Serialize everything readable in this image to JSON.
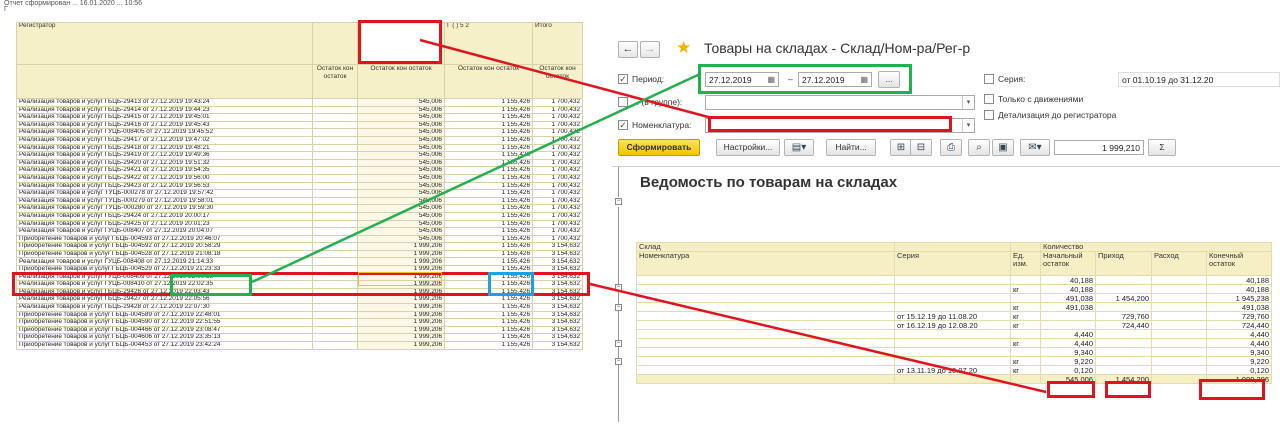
{
  "left_report": {
    "top_line": "Отчет сформирован ... 16.01.2020 ... 10:56",
    "top_line2": "Г",
    "headers": {
      "registrar": "Регистратор",
      "c2_top": "",
      "c3_top": "Г    (    ) 5   2",
      "total": "Итого",
      "c1_sub": "Остаток кон остаток",
      "c2_sub": "Остаток кон остаток",
      "c3_sub": "Остаток кон остаток",
      "c4_sub": "Остаток кон остаток"
    },
    "rows": [
      {
        "r": "Реализация товаров и услуг ГБЦБ-29413 от 27.12.2019 19:43:24",
        "a": "545,006",
        "b": "1 155,426",
        "t": "1 700,432"
      },
      {
        "r": "Реализация товаров и услуг ГБЦБ-29414 от 27.12.2019 19:44:23",
        "a": "545,006",
        "b": "1 155,426",
        "t": "1 700,432"
      },
      {
        "r": "Реализация товаров и услуг ГБЦБ-29415 от 27.12.2019 19:45:01",
        "a": "545,006",
        "b": "1 155,426",
        "t": "1 700,432"
      },
      {
        "r": "Реализация товаров и услуг ГБЦБ-29416 от 27.12.2019 19:45:43",
        "a": "545,006",
        "b": "1 155,426",
        "t": "1 700,432"
      },
      {
        "r": "Реализация товаров и услуг ГУЦБ-008405 от 27.12.2019 19:45:52",
        "a": "545,006",
        "b": "1 155,426",
        "t": "1 700,432"
      },
      {
        "r": "Реализация товаров и услуг ГБЦБ-29417 от 27.12.2019 19:47:02",
        "a": "545,006",
        "b": "1 155,426",
        "t": "1 700,432"
      },
      {
        "r": "Реализация товаров и услуг ГБЦБ-29418 от 27.12.2019 19:48:21",
        "a": "545,006",
        "b": "1 155,426",
        "t": "1 700,432"
      },
      {
        "r": "Реализация товаров и услуг ГБЦБ-29419 от 27.12.2019 19:49:36",
        "a": "545,006",
        "b": "1 155,426",
        "t": "1 700,432"
      },
      {
        "r": "Реализация товаров и услуг ГБЦБ-29420 от 27.12.2019 19:51:32",
        "a": "545,006",
        "b": "1 155,426",
        "t": "1 700,432"
      },
      {
        "r": "Реализация товаров и услуг ГБЦБ-29421 от 27.12.2019 19:54:35",
        "a": "545,006",
        "b": "1 155,426",
        "t": "1 700,432"
      },
      {
        "r": "Реализация товаров и услуг ГБЦБ-29422 от 27.12.2019 19:56:00",
        "a": "545,006",
        "b": "1 155,426",
        "t": "1 700,432"
      },
      {
        "r": "Реализация товаров и услуг ГБЦБ-29423 от 27.12.2019 19:56:53",
        "a": "545,006",
        "b": "1 155,426",
        "t": "1 700,432"
      },
      {
        "r": "Реализация товаров и услуг ТУЦБ-000278 от 27.12.2019 19:57:42",
        "a": "545,006",
        "b": "1 155,426",
        "t": "1 700,432"
      },
      {
        "r": "Реализация товаров и услуг ТУЦБ-000279 от 27.12.2019 19:58:01",
        "a": "545,006",
        "b": "1 155,426",
        "t": "1 700,432"
      },
      {
        "r": "Реализация товаров и услуг ТУЦБ-000280 от 27.12.2019 19:59:30",
        "a": "545,006",
        "b": "1 155,426",
        "t": "1 700,432"
      },
      {
        "r": "Реализация товаров и услуг ГБЦБ-29424 от 27.12.2019 20:00:17",
        "a": "545,006",
        "b": "1 155,426",
        "t": "1 700,432"
      },
      {
        "r": "Реализация товаров и услуг ГБЦБ-29425 от 27.12.2019 20:01:23",
        "a": "545,006",
        "b": "1 155,426",
        "t": "1 700,432"
      },
      {
        "r": "Реализация товаров и услуг ГУЦБ-008407 от 27.12.2019 20:04:07",
        "a": "545,006",
        "b": "1 155,426",
        "t": "1 700,432"
      },
      {
        "r": "Приобретение товаров и услуг ГБЦБ-004593 от 27.12.2019 20:46:07",
        "a": "545,006",
        "b": "1 155,426",
        "t": "1 700,432"
      },
      {
        "r": "Приобретение товаров и услуг ГБЦБ-004592 от 27.12.2019 20:58:29",
        "a": "1 999,206",
        "b": "1 155,426",
        "t": "3 154,632"
      },
      {
        "r": "Приобретение товаров и услуг ГБЦБ-004528 от 27.12.2019 21:08:18",
        "a": "1 999,206",
        "b": "1 155,426",
        "t": "3 154,632"
      },
      {
        "r": "Реализация товаров и услуг ГУЦБ-008408 от 27.12.2019 21:14:33",
        "a": "1 999,206",
        "b": "1 155,426",
        "t": "3 154,632"
      },
      {
        "r": "Приобретение товаров и услуг ГБЦБ-004529 от 27.12.2019 21:23:33",
        "a": "1 999,206",
        "b": "1 155,426",
        "t": "3 154,632"
      },
      {
        "r": "Реализация товаров и услуг ГУЦБ-008409 от 27.12.2019 22:00:58",
        "a": "1 999,206",
        "b": "1 155,426",
        "t": "3 154,632"
      },
      {
        "r": "Реализация товаров и услуг ГУЦБ-008410 от 27.12.2019 22:02:35",
        "a": "1 999,206",
        "b": "1 155,426",
        "t": "3 154,632"
      },
      {
        "r": "Реализация товаров и услуг ГБЦБ-29426 от 27.12.2019 22:03:43",
        "a": "1 999,206",
        "b": "1 155,426",
        "t": "3 154,632"
      },
      {
        "r": "Реализация товаров и услуг ГБЦБ-29427 от 27.12.2019 22:05:56",
        "a": "1 999,206",
        "b": "1 155,426",
        "t": "3 154,632"
      },
      {
        "r": "Реализация товаров и услуг ГБЦБ-29428 от 27.12.2019 22:07:30",
        "a": "1 999,206",
        "b": "1 155,426",
        "t": "3 154,632"
      },
      {
        "r": "Приобретение товаров и услуг ГБЦБ-004589 от 27.12.2019 22:48:01",
        "a": "1 999,206",
        "b": "1 155,426",
        "t": "3 154,632"
      },
      {
        "r": "Приобретение товаров и услуг ГБЦБ-004590 от 27.12.2019 22:51:55",
        "a": "1 999,206",
        "b": "1 155,426",
        "t": "3 154,632"
      },
      {
        "r": "Приобретение товаров и услуг ГБЦБ-004466 от 27.12.2019 23:08:47",
        "a": "1 999,206",
        "b": "1 155,426",
        "t": "3 154,632"
      },
      {
        "r": "Приобретение товаров и услуг ГБЦБ-004606 от 27.12.2019 23:35:13",
        "a": "1 999,206",
        "b": "1 155,426",
        "t": "3 154,632"
      },
      {
        "r": "Приобретение товаров и услуг ГБЦБ-004453 от 27.12.2019 23:42:24",
        "a": "1 999,206",
        "b": "1 155,426",
        "t": "3 154,632"
      }
    ]
  },
  "window": {
    "back": "←",
    "forward": "→",
    "title": "Товары на складах - Склад/Ном-ра/Рег-р",
    "period_label": "Период:",
    "period_from": "27.12.2019",
    "period_dash": "–",
    "period_to": "27.12.2019",
    "period_btn": "...",
    "group_label": "... (в группе):",
    "nomenclature_label": "Номенклатура:",
    "series_label": "Серия:",
    "series_value": "от 01.10.19 до 31.12.20",
    "only_moves_label": "Только с движениями",
    "detail_label": "Детализация до регистратора",
    "btn_form": "Сформировать",
    "btn_settings": "Настройки...",
    "btn_find": "Найти...",
    "sum_value": "1 999,210",
    "sigma": "Σ"
  },
  "report": {
    "title": "Ведомость по товарам на складах",
    "headers": {
      "sklad": "Склад",
      "nomen": "Номенклатура",
      "series": "Серия",
      "unit": "Ед. изм.",
      "qty": "Количество",
      "start": "Начальный остаток",
      "in": "Приход",
      "out": "Расход",
      "end": "Конечный остаток"
    },
    "rows": [
      {
        "s": "",
        "u": "",
        "a": "40,188",
        "i": "",
        "o": "",
        "e": "40,188"
      },
      {
        "s": "",
        "u": "кг",
        "a": "40,188",
        "i": "",
        "o": "",
        "e": "40,188"
      },
      {
        "s": "",
        "u": "",
        "a": "491,038",
        "i": "1 454,200",
        "o": "",
        "e": "1 945,238"
      },
      {
        "s": "",
        "u": "кг",
        "a": "491,038",
        "i": "",
        "o": "",
        "e": "491,038"
      },
      {
        "s": "от 15.12.19 до 11.08.20",
        "u": "кг",
        "a": "",
        "i": "729,760",
        "o": "",
        "e": "729,760"
      },
      {
        "s": "от 16.12.19 до 12.08.20",
        "u": "кг",
        "a": "",
        "i": "724,440",
        "o": "",
        "e": "724,440"
      },
      {
        "s": "",
        "u": "",
        "a": "4,440",
        "i": "",
        "o": "",
        "e": "4,440"
      },
      {
        "s": "",
        "u": "кг",
        "a": "4,440",
        "i": "",
        "o": "",
        "e": "4,440"
      },
      {
        "s": "",
        "u": "",
        "a": "9,340",
        "i": "",
        "o": "",
        "e": "9,340"
      },
      {
        "s": "",
        "u": "кг",
        "a": "9,220",
        "i": "",
        "o": "",
        "e": "9,220"
      },
      {
        "s": "от 13.11.19 до 10.07.20",
        "u": "кг",
        "a": "0,120",
        "i": "",
        "o": "",
        "e": "0,120"
      }
    ],
    "total": {
      "a": "545,006",
      "i": "1 454,200",
      "o": "",
      "e": "1 999,206"
    }
  },
  "annotation_colors": {
    "red": "#e0141e",
    "green": "#22b14c",
    "blue": "#1ea0dc"
  }
}
